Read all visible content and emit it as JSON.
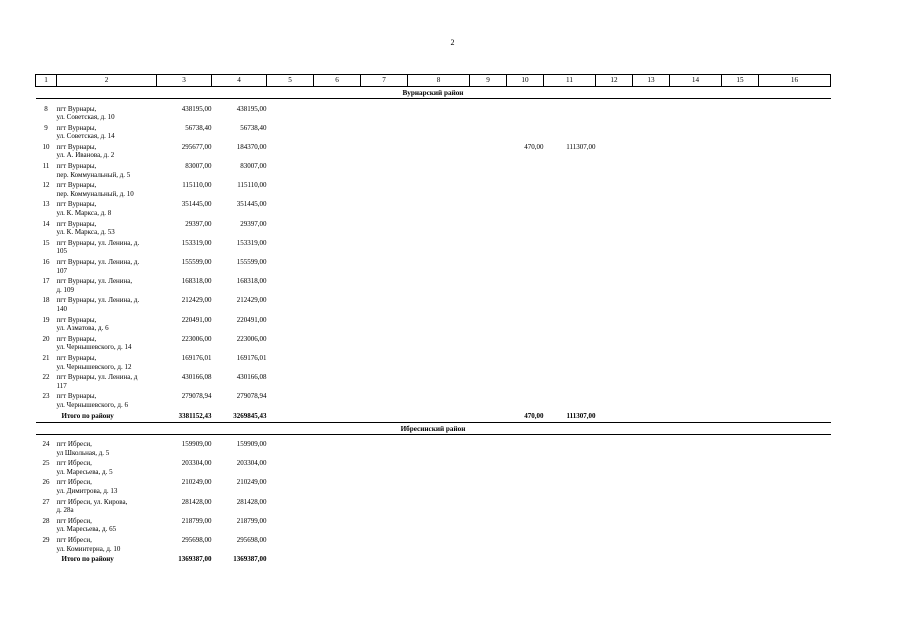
{
  "document": {
    "page_number": "2",
    "column_headers": [
      "1",
      "2",
      "3",
      "4",
      "5",
      "6",
      "7",
      "8",
      "9",
      "10",
      "11",
      "12",
      "13",
      "14",
      "15",
      "16"
    ],
    "total_label": "Итого по району",
    "sections": [
      {
        "district": "Вурнарский район",
        "rows": [
          {
            "n": "8",
            "name": "пгт Вурнары,",
            "addr": "ул. Советская, д. 10",
            "c3": "438195,00",
            "c4": "438195,00",
            "c10": "",
            "c11": ""
          },
          {
            "n": "9",
            "name": "пгт Вурнары,",
            "addr": "ул. Советская, д. 14",
            "c3": "56738,40",
            "c4": "56738,40",
            "c10": "",
            "c11": ""
          },
          {
            "n": "10",
            "name": "пгт Вурнары,",
            "addr": "ул. А. Иванова, д. 2",
            "c3": "295677,00",
            "c4": "184370,00",
            "c10": "470,00",
            "c11": "111307,00"
          },
          {
            "n": "11",
            "name": "пгт Вурнары,",
            "addr": "пер. Коммунальный, д. 5",
            "c3": "83007,00",
            "c4": "83007,00",
            "c10": "",
            "c11": ""
          },
          {
            "n": "12",
            "name": "пгт Вурнары,",
            "addr": "пер. Коммунальный, д. 10",
            "c3": "115110,00",
            "c4": "115110,00",
            "c10": "",
            "c11": ""
          },
          {
            "n": "13",
            "name": "пгт Вурнары,",
            "addr": "ул. К. Маркса, д. 8",
            "c3": "351445,00",
            "c4": "351445,00",
            "c10": "",
            "c11": ""
          },
          {
            "n": "14",
            "name": "пгт Вурнары,",
            "addr": "ул. К. Маркса, д. 53",
            "c3": "29397,00",
            "c4": "29397,00",
            "c10": "",
            "c11": ""
          },
          {
            "n": "15",
            "name": "пгт Вурнары, ул. Ленина, д.",
            "addr": "105",
            "c3": "153319,00",
            "c4": "153319,00",
            "c10": "",
            "c11": ""
          },
          {
            "n": "16",
            "name": "пгт Вурнары, ул. Ленина, д.",
            "addr": "107",
            "c3": "155599,00",
            "c4": "155599,00",
            "c10": "",
            "c11": ""
          },
          {
            "n": "17",
            "name": "пгт Вурнары,  ул. Ленина,",
            "addr": "д. 109",
            "c3": "168318,00",
            "c4": "168318,00",
            "c10": "",
            "c11": ""
          },
          {
            "n": "18",
            "name": "пгт Вурнары, ул. Ленина, д.",
            "addr": "140",
            "c3": "212429,00",
            "c4": "212429,00",
            "c10": "",
            "c11": ""
          },
          {
            "n": "19",
            "name": "пгт Вурнары,",
            "addr": "ул. Азматова, д. 6",
            "c3": "220491,00",
            "c4": "220491,00",
            "c10": "",
            "c11": ""
          },
          {
            "n": "20",
            "name": "пгт Вурнары,",
            "addr": "ул. Чернышевского, д. 14",
            "c3": "223006,00",
            "c4": "223006,00",
            "c10": "",
            "c11": ""
          },
          {
            "n": "21",
            "name": "пгт Вурнары,",
            "addr": "ул. Чернышевского, д. 12",
            "c3": "169176,01",
            "c4": "169176,01",
            "c10": "",
            "c11": ""
          },
          {
            "n": "22",
            "name": "пгт Вурнары, ул. Ленина, д",
            "addr": "117",
            "c3": "430166,08",
            "c4": "430166,08",
            "c10": "",
            "c11": ""
          },
          {
            "n": "23",
            "name": "пгт Вурнары,",
            "addr": "ул. Чернышевского, д. 6",
            "c3": "279078,94",
            "c4": "279078,94",
            "c10": "",
            "c11": ""
          }
        ],
        "total": {
          "c3": "3381152,43",
          "c4": "3269845,43",
          "c10": "470,00",
          "c11": "111307,00"
        }
      },
      {
        "district": "Ибресинский район",
        "rows": [
          {
            "n": "24",
            "name": "пгт Ибреси,",
            "addr": "ул Школьная, д. 5",
            "c3": "159909,00",
            "c4": "159909,00",
            "c10": "",
            "c11": ""
          },
          {
            "n": "25",
            "name": "пгт Ибреси,",
            "addr": "ул. Маресьева, д. 5",
            "c3": "203304,00",
            "c4": "203304,00",
            "c10": "",
            "c11": ""
          },
          {
            "n": "26",
            "name": "пгт Ибреси,",
            "addr": "ул. Димитрова,  д. 13",
            "c3": "210249,00",
            "c4": "210249,00",
            "c10": "",
            "c11": ""
          },
          {
            "n": "27",
            "name": "пгт Ибреси,  ул. Кирова,",
            "addr": "д. 28а",
            "c3": "281428,00",
            "c4": "281428,00",
            "c10": "",
            "c11": ""
          },
          {
            "n": "28",
            "name": "пгт Ибреси,",
            "addr": "ул. Маресьева, д. 65",
            "c3": "218799,00",
            "c4": "218799,00",
            "c10": "",
            "c11": ""
          },
          {
            "n": "29",
            "name": "пгт Ибреси,",
            "addr": "ул. Коминтерна, д. 10",
            "c3": "295698,00",
            "c4": "295698,00",
            "c10": "",
            "c11": ""
          }
        ],
        "total": {
          "c3": "1369387,00",
          "c4": "1369387,00",
          "c10": "",
          "c11": ""
        }
      }
    ]
  }
}
